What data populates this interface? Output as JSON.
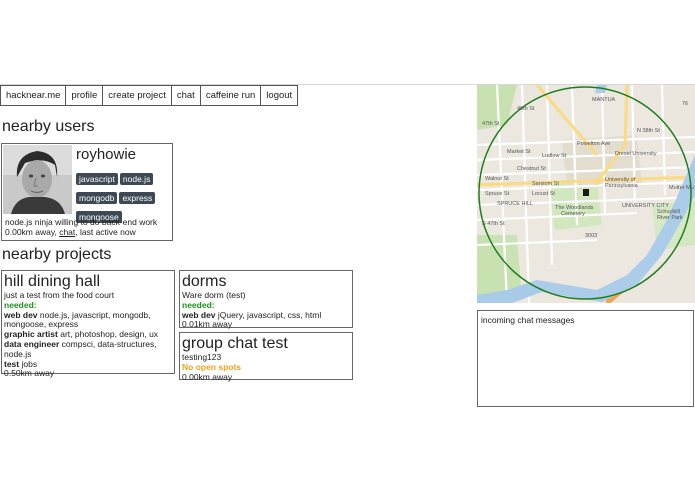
{
  "nav": {
    "items": [
      "hacknear.me",
      "profile",
      "create project",
      "chat",
      "caffeine run",
      "logout"
    ]
  },
  "sections": {
    "users_heading": "nearby users",
    "projects_heading": "nearby projects"
  },
  "user": {
    "name": "royhowie",
    "tags": [
      "javascript",
      "node.js",
      "mongodb",
      "express",
      "mongoose"
    ],
    "bio": "node.js ninja willing to do back-end work",
    "distance": "0.00km away,",
    "chat_link": "chat",
    "status": ", last active now"
  },
  "projects": [
    {
      "title": "hill dining hall",
      "description": "just a test from the food court",
      "needed_label": "needed:",
      "roles": [
        {
          "role": "web dev",
          "skills": "node.js, javascript, mongodb, mongoose, express"
        },
        {
          "role": "graphic artist",
          "skills": "art, photoshop, design, ux"
        },
        {
          "role": "data engineer",
          "skills": "compsci, data-structures, node.js"
        },
        {
          "role": "test",
          "skills": "jobs"
        }
      ],
      "distance": "0.50km away"
    },
    {
      "title": "dorms",
      "description": "Ware dorm (test)",
      "needed_label": "needed:",
      "roles": [
        {
          "role": "web dev",
          "skills": "jQuery, javascript, css, html"
        }
      ],
      "distance": "0.01km away"
    },
    {
      "title": "group chat test",
      "description": "testing123",
      "status": "No open spots",
      "distance": "0.00km away"
    }
  ],
  "map": {
    "labels": [
      "MANTUA",
      "Drexel University",
      "University of Pennsylvania",
      "The Woodlands Cemetery",
      "UNIVERSITY CITY",
      "SPRUCE HILL",
      "Schuylkill River Park",
      "Powelton Ave",
      "Market St",
      "Chestnut St",
      "Walnut St",
      "Spruce St",
      "Ludlow St",
      "Sansom St",
      "Locust St",
      "N 38th St",
      "S 47th St",
      "47th St",
      "46th St",
      "Mutter Mu",
      "3003",
      "76"
    ],
    "colors": {
      "water": "#a7cbe8",
      "park": "#c7e2b0",
      "highway": "#f4a34b",
      "major_road": "#fbd87b",
      "radius": "#1e7e1e"
    }
  },
  "chat": {
    "title": "incoming chat messages"
  }
}
